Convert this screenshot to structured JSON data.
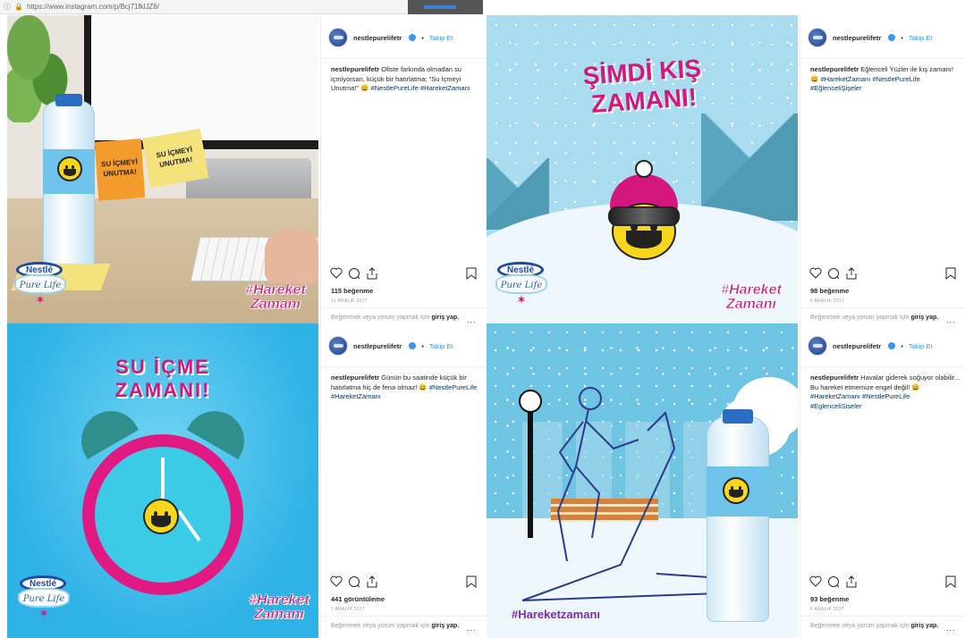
{
  "browser": {
    "url": "https://www.instagram.com/p/Bcj71fklJZ6/"
  },
  "account": {
    "username": "nestlepurelifetr",
    "separator": "•",
    "follow_label": "Takip Et"
  },
  "comment_prompt": {
    "text": "Beğenmek veya yorum yapmak için",
    "link": "giriş yap."
  },
  "more_label": "...",
  "posts": [
    {
      "caption_user": "nestlepurelifetr",
      "caption_text": "Ofiste farkında olmadan su içmiyorsan, küçük bir hatırlatma; \"Su İçmeyi Unutma!\" 😄",
      "caption_tags": "#NestlePureLife #HareketZamanı",
      "count": "115 beğenme",
      "date": "11 ARALIK 2017",
      "image": {
        "note_orange": "SU İÇMEYİ UNUTMA!",
        "note_yellow": "SU İÇMEYİ UNUTMA!",
        "logo_brand": "Nestlé",
        "logo_sub": "Pure Life",
        "hashtag": "#Hareket Zamanı"
      }
    },
    {
      "caption_user": "nestlepurelifetr",
      "caption_text": "Eğlenceli Yüzler ile kış zamanı! 😄",
      "caption_tags": "#HareketZamanı #NestlePureLife #EğlenceliŞişeler",
      "count": "98 beğenme",
      "date": "6 ARALIK 2017",
      "image": {
        "headline_1": "ŞİMDİ KIŞ",
        "headline_2": "ZAMANI!",
        "logo_brand": "Nestlé",
        "logo_sub": "Pure Life",
        "hashtag": "#Hareket Zamanı"
      }
    },
    {
      "caption_user": "nestlepurelifetr",
      "caption_text": "Günün bu saatinde küçük bir hatırlatma hiç de fena olmaz! 😄",
      "caption_tags": "#NestlePureLife #HareketZamanı",
      "count": "441 görüntüleme",
      "date": "7 ARALIK 2017",
      "image": {
        "headline_1": "SU İÇME",
        "headline_2": "ZAMANI!",
        "logo_brand": "Nestlé",
        "logo_sub": "Pure Life",
        "hashtag": "#Hareket Zamanı"
      }
    },
    {
      "caption_user": "nestlepurelifetr",
      "caption_text": "Havalar giderek soğuyor olabilir... Bu hareket etmemize engel değil! 😄",
      "caption_tags": "#HareketZamanı #NestlePureLife #EglenceliSiseler",
      "count": "93 beğenme",
      "date": "6 ARALIK 2017",
      "image": {
        "hashtag": "#Hareketzamanı"
      }
    }
  ],
  "icons": [
    "heart-icon",
    "comment-icon",
    "share-icon",
    "bookmark-icon",
    "lock-icon",
    "verified-badge-icon"
  ],
  "colors": {
    "link_blue": "#3897f0",
    "brand_pink": "#d4177f",
    "brand_blue": "#1f4a9c",
    "sky_blue": "#2fb3e6",
    "winter_blue": "#a9dcee"
  }
}
